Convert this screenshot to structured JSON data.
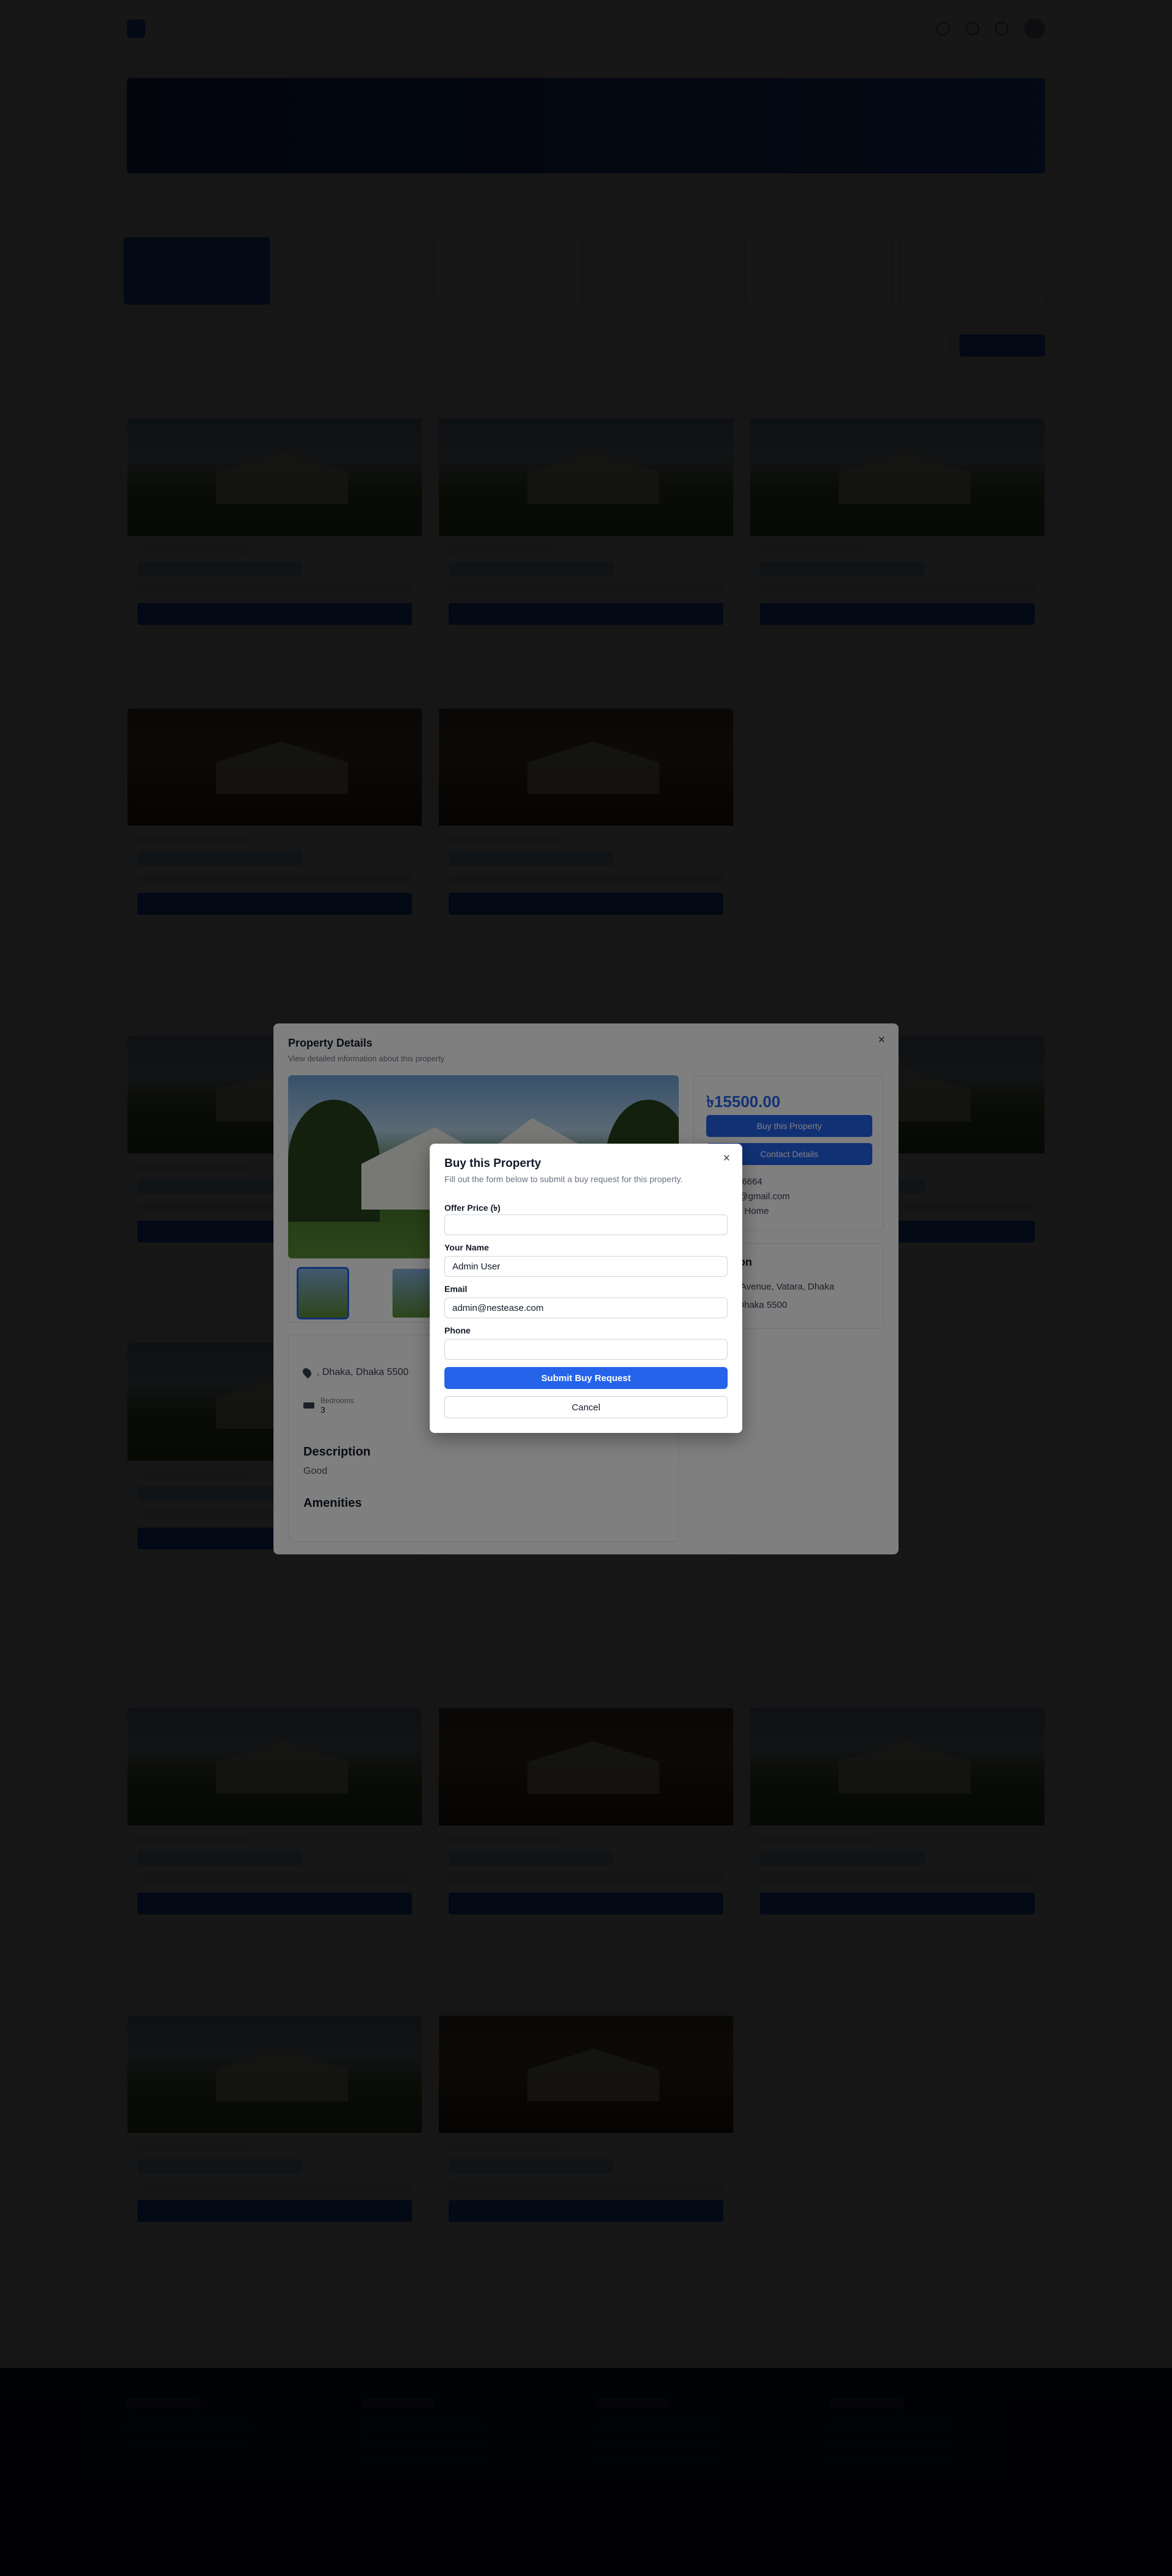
{
  "navbar": {
    "links": [
      "",
      "",
      "",
      ""
    ]
  },
  "property_details": {
    "title": "Property Details",
    "subtitle": "View detailed information about this property",
    "close_icon": "×",
    "price": "৳15500.00",
    "buy_label": "Buy this Property",
    "contact_label": "Contact Details",
    "phone": "01656556664",
    "email_partial": "landlord@gmail.com",
    "owner_partial": "Landlord Home",
    "location_title": "Location",
    "location_line1": "Road 3, Avenue, Vatara, Dhaka",
    "location_line2": "Vatara, Dhaka 5500",
    "address": ", Dhaka, Dhaka 5500",
    "bedrooms_label": "Bedrooms",
    "bedrooms_value": "3",
    "description_heading": "Description",
    "description_text": "Good",
    "amenities_heading": "Amenities"
  },
  "buy_modal": {
    "title": "Buy this Property",
    "description": "Fill out the form below to submit a buy request for this property.",
    "close_icon": "×",
    "offer_price_label": "Offer Price (৳)",
    "offer_price_value": "",
    "name_label": "Your Name",
    "name_value": "Admin User",
    "email_label": "Email",
    "email_value": "admin@nestease.com",
    "phone_label": "Phone",
    "phone_value": "",
    "submit_label": "Submit Buy Request",
    "cancel_label": "Cancel"
  },
  "colors": {
    "primary": "#2563eb",
    "overlay": "rgba(0,0,0,0.82)"
  }
}
